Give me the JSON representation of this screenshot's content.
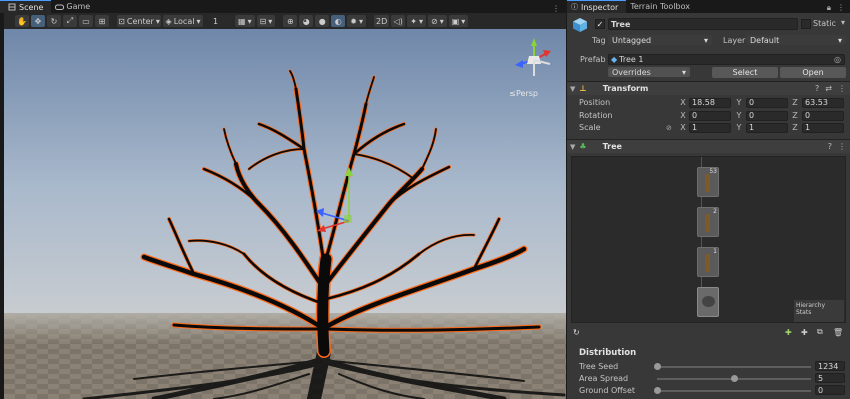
{
  "scene_panel": {
    "tabs": [
      {
        "label": "Scene",
        "icon": "scene-icon"
      },
      {
        "label": "Game",
        "icon": "gamepad-icon"
      }
    ],
    "toolbar": {
      "tools": [
        "hand-tool-icon",
        "move-tool-icon",
        "rotate-tool-icon",
        "scale-tool-icon",
        "rect-tool-icon",
        "transform-tool-icon"
      ],
      "pivot_label": "Center",
      "space_label": "Local",
      "snap_value": "1",
      "mode_2d": "2D"
    },
    "gizmo": {
      "projection_label": "Persp"
    }
  },
  "inspector": {
    "tabs": [
      {
        "label": "Inspector",
        "icon": "info-icon"
      },
      {
        "label": "Terrain Toolbox"
      }
    ],
    "object": {
      "name": "Tree",
      "active": true,
      "static_label": "Static",
      "tag_label": "Tag",
      "tag_value": "Untagged",
      "layer_label": "Layer",
      "layer_value": "Default",
      "prefab_label": "Prefab",
      "prefab_value": "Tree 1",
      "overrides_label": "Overrides",
      "select_label": "Select",
      "open_label": "Open"
    },
    "transform": {
      "title": "Transform",
      "rows": [
        {
          "label": "Position",
          "x": "18.58",
          "y": "0",
          "z": "63.53"
        },
        {
          "label": "Rotation",
          "x": "0",
          "y": "0",
          "z": "0"
        },
        {
          "label": "Scale",
          "x": "1",
          "y": "1",
          "z": "1"
        }
      ],
      "axes": [
        "X",
        "Y",
        "Z"
      ]
    },
    "tree": {
      "title": "Tree",
      "hierarchy_label": "Hierarchy Stats",
      "node_badges": [
        "53",
        "2",
        "1"
      ]
    },
    "distribution": {
      "title": "Distribution",
      "sliders": [
        {
          "label": "Tree Seed",
          "value": "1234",
          "fraction": 0.0
        },
        {
          "label": "Area Spread",
          "value": "5",
          "fraction": 0.5
        },
        {
          "label": "Ground Offset",
          "value": "0",
          "fraction": 0.0
        }
      ]
    }
  }
}
